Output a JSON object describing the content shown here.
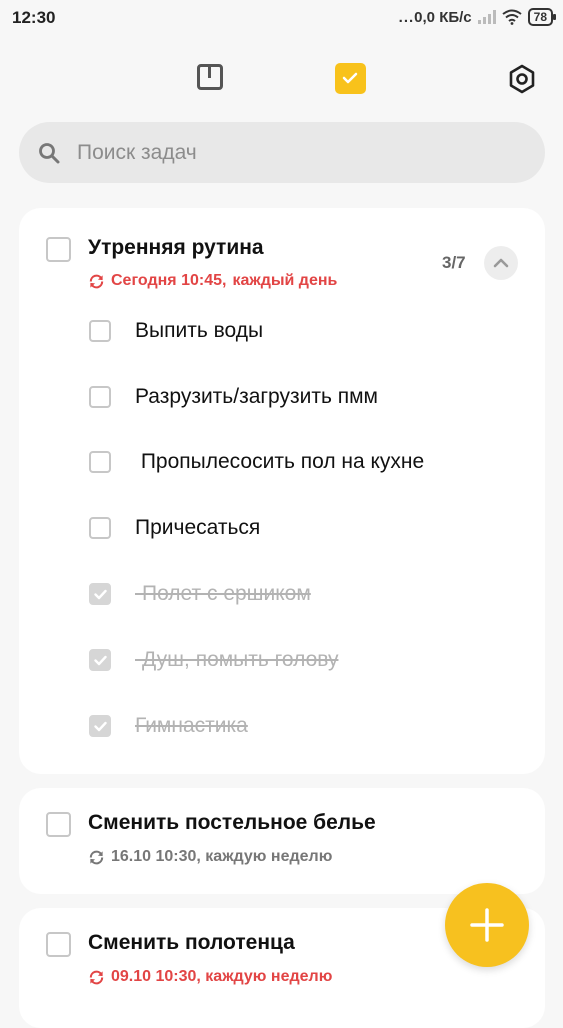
{
  "status_bar": {
    "time": "12:30",
    "dots": "...",
    "network_speed": "0,0 КБ/с",
    "battery": "78"
  },
  "topbar": {
    "notes_icon": "notes-icon",
    "tasks_icon": "tasks-checkbox-icon",
    "settings_icon": "settings-hex-icon"
  },
  "search": {
    "placeholder": "Поиск задач",
    "value": ""
  },
  "colors": {
    "accent": "#f8c21b",
    "overdue": "#e24545",
    "muted": "#777777"
  },
  "tasks": [
    {
      "title": "Утренняя рутина",
      "date": "Сегодня 10:45,",
      "repeat": "каждый день",
      "progress": "3/7",
      "expanded": true,
      "subtasks": [
        {
          "label": "Выпить воды",
          "done": false
        },
        {
          "label": "Разрузить/загрузить пмм",
          "done": false
        },
        {
          "label": " Пропылесосить пол на кухне",
          "done": false
        },
        {
          "label": "Причесаться",
          "done": false
        },
        {
          "label": "-Полет с ершиком",
          "done": true
        },
        {
          "label": "-Душ, помыть голову",
          "done": true
        },
        {
          "label": "Гимнастика",
          "done": true
        }
      ]
    },
    {
      "title": "Сменить постельное белье",
      "meta": "16.10 10:30, каждую неделю"
    },
    {
      "title": "Сменить полотенца",
      "meta": "09.10 10:30, каждую неделю"
    }
  ]
}
